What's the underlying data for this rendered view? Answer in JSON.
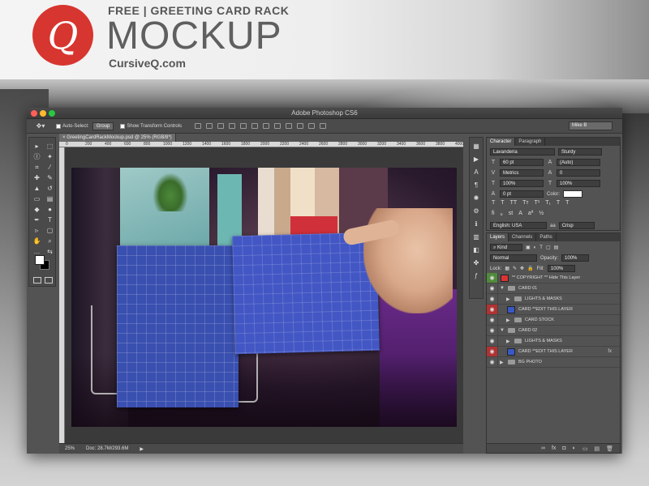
{
  "branding": {
    "logo_glyph": "Q",
    "headline": "FREE  |  GREETING CARD RACK",
    "title": "MOCKUP",
    "site": "CursiveQ.com"
  },
  "window": {
    "title": "Adobe Photoshop CS6",
    "document_tab": "GreetingCardRackMockup.psd @ 25% (RGB/8*)",
    "workspace": "Mike B"
  },
  "options_bar": {
    "auto_select_label": "Auto-Select:",
    "auto_select_value": "Group",
    "transform_label": "Show Transform Controls"
  },
  "ruler": {
    "h_ticks": [
      "0",
      "200",
      "400",
      "600",
      "800",
      "1000",
      "1200",
      "1400",
      "1600",
      "1800",
      "2000",
      "2200",
      "2400",
      "2600",
      "2800",
      "3000",
      "3200",
      "3400",
      "3600",
      "3800",
      "4000"
    ]
  },
  "statusbar": {
    "zoom": "25%",
    "doc": "Doc: 28.7M/293.6M"
  },
  "character_panel": {
    "tabs": [
      "Character",
      "Paragraph"
    ],
    "font_family": "Lavanderia",
    "font_style": "Sturdy",
    "size": "60 pt",
    "leading": "(Auto)",
    "kerning": "Metrics",
    "tracking": "0",
    "vscale": "100%",
    "hscale": "100%",
    "baseline": "0 pt",
    "color_label": "Color:",
    "language": "English: USA",
    "aa_label": "aa",
    "antialias": "Crisp"
  },
  "layers_panel": {
    "tabs": [
      "Layers",
      "Channels",
      "Paths"
    ],
    "kind": "Kind",
    "blend_mode": "Normal",
    "opacity_label": "Opacity:",
    "opacity": "100%",
    "lock_label": "Lock:",
    "fill_label": "Fill:",
    "fill": "100%",
    "layers": [
      {
        "name": "** COPYRIGHT ** Hide This Layer",
        "type": "thumb-red",
        "eye": "green",
        "indent": 0,
        "fx": ""
      },
      {
        "name": "CARD 01",
        "type": "folder",
        "eye": "normal",
        "indent": 0,
        "fx": "",
        "arrow": "▼"
      },
      {
        "name": "LIGHTS & MASKS",
        "type": "folder",
        "eye": "normal",
        "indent": 1,
        "fx": "",
        "arrow": "▶"
      },
      {
        "name": "CARD **EDIT THIS LAYER",
        "type": "thumb-blue",
        "eye": "red",
        "indent": 1,
        "fx": ""
      },
      {
        "name": "CARD STOCK",
        "type": "folder",
        "eye": "normal",
        "indent": 1,
        "fx": "",
        "arrow": "▶"
      },
      {
        "name": "CARD 02",
        "type": "folder",
        "eye": "normal",
        "indent": 0,
        "fx": "",
        "arrow": "▼"
      },
      {
        "name": "LIGHTS & MASKS",
        "type": "folder",
        "eye": "normal",
        "indent": 1,
        "fx": "",
        "arrow": "▶"
      },
      {
        "name": "CARD **EDIT THIS LAYER",
        "type": "thumb-blue",
        "eye": "red",
        "indent": 1,
        "fx": "fx"
      },
      {
        "name": "BG PHOTO",
        "type": "folder",
        "eye": "normal",
        "indent": 0,
        "fx": "",
        "arrow": "▶"
      }
    ]
  },
  "colors": {
    "logo_red": "#d7352f",
    "card_blue": "#3a50b0",
    "panel_gray": "#535353"
  }
}
